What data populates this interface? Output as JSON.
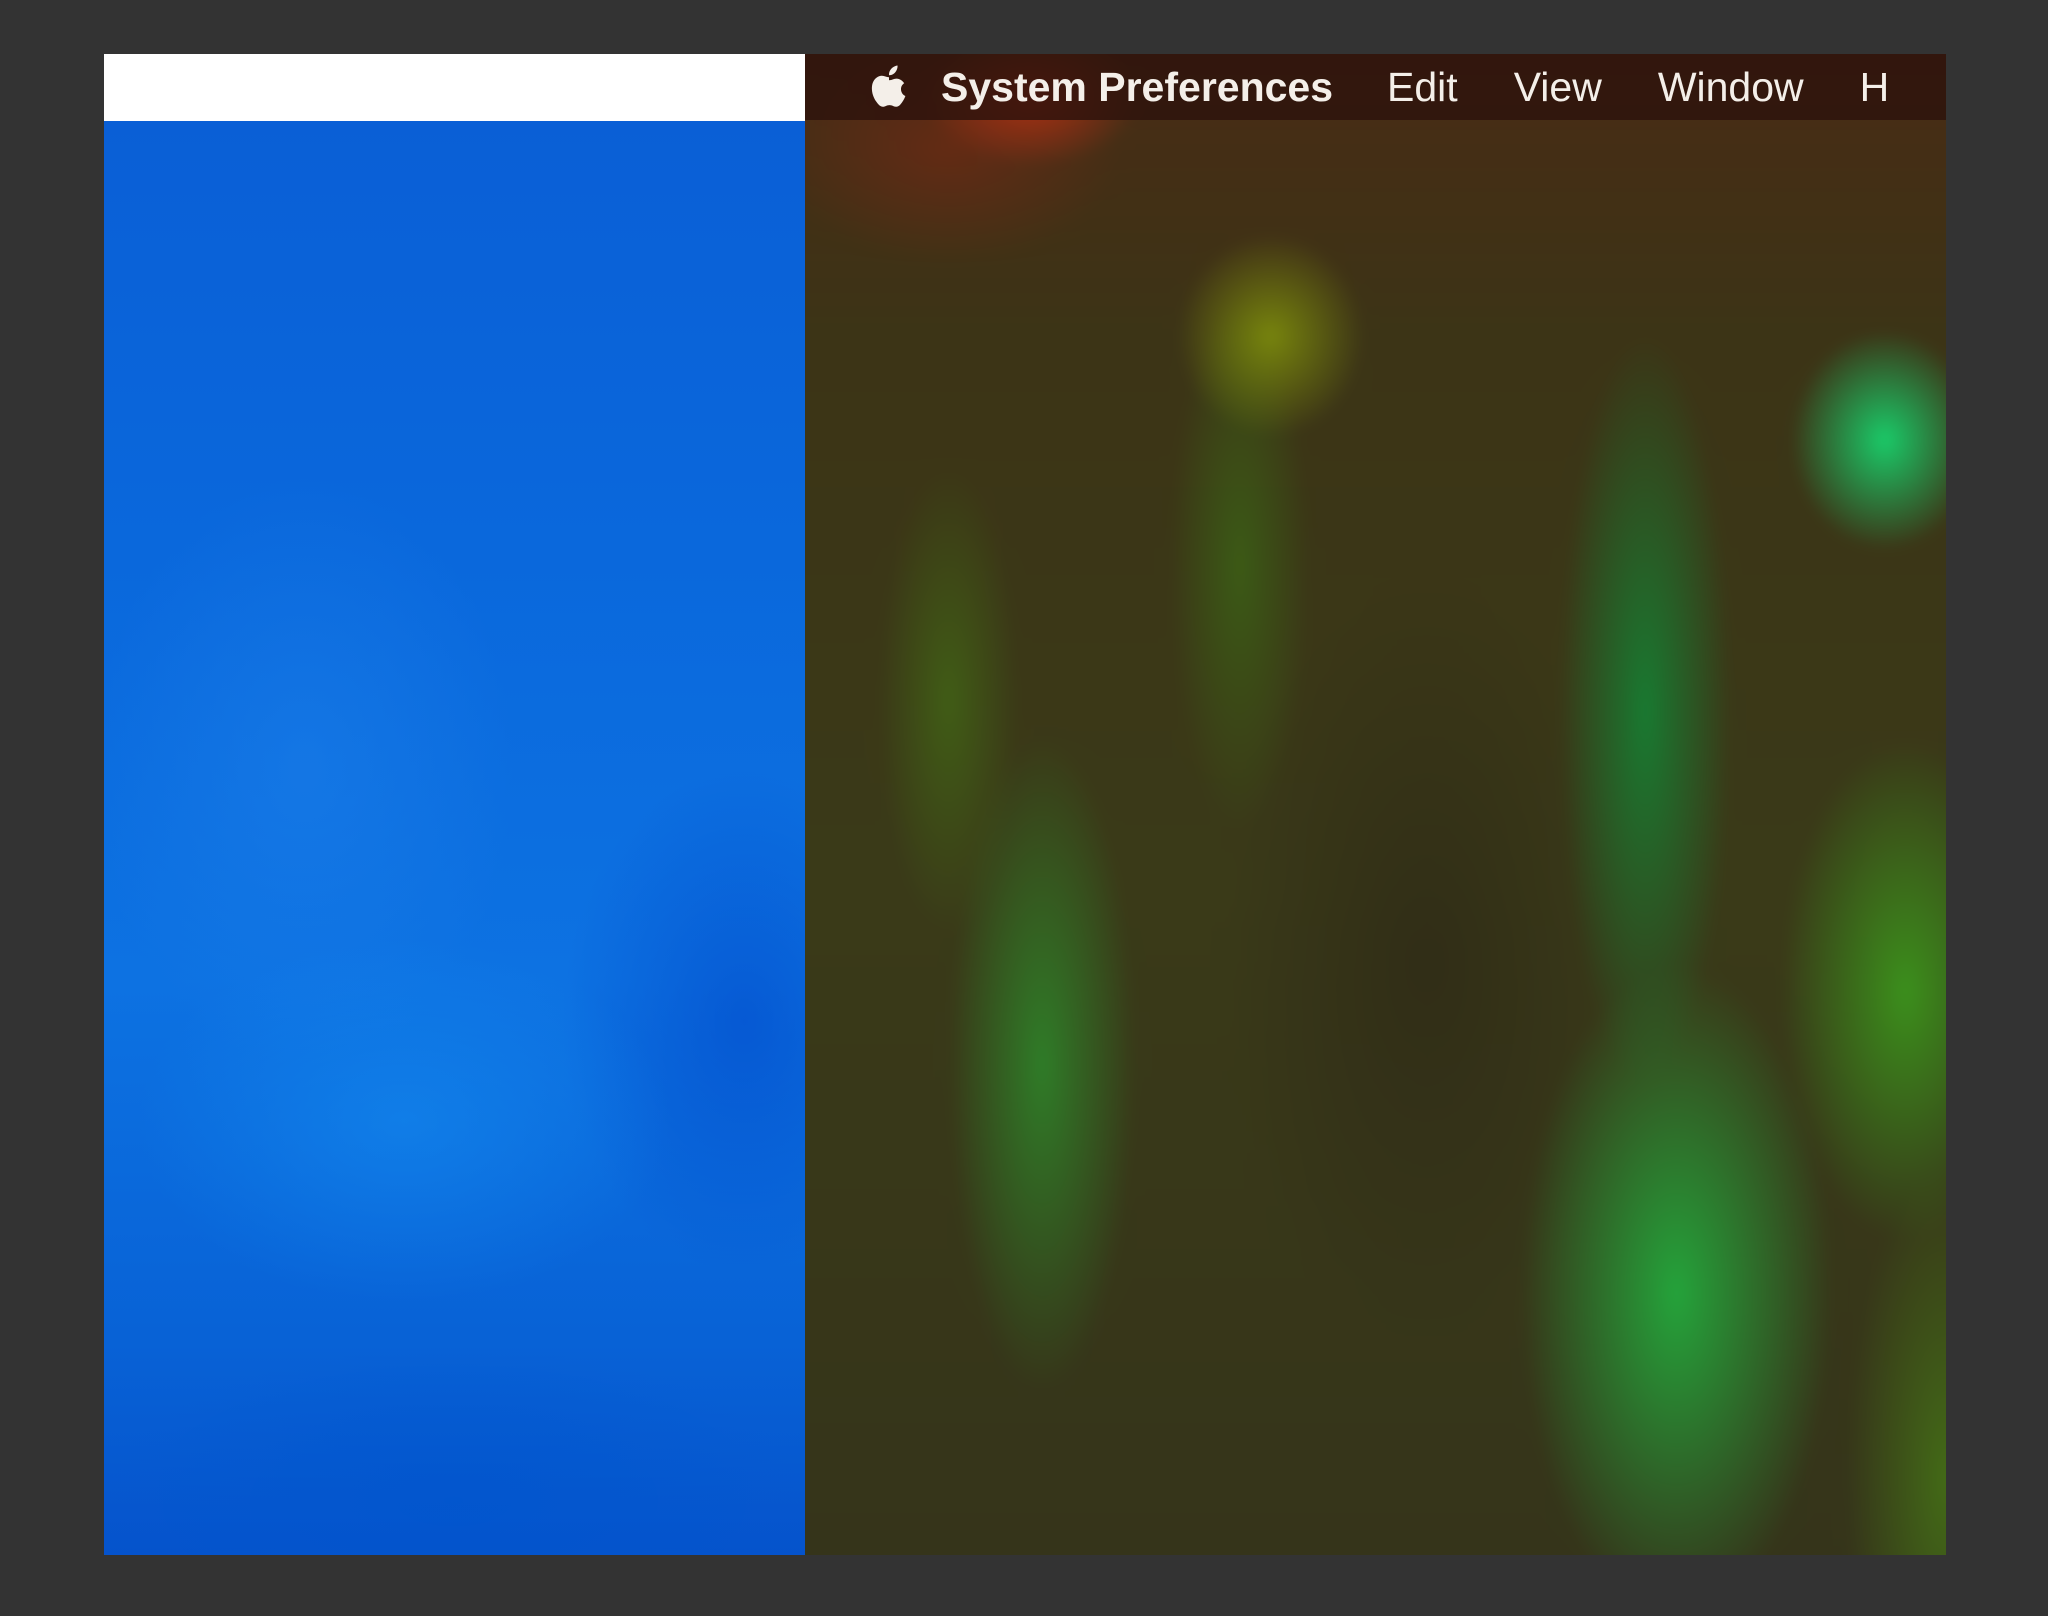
{
  "menubar": {
    "apple_menu": "apple-icon",
    "app_name": "System Preferences",
    "items": [
      "Edit",
      "View",
      "Window",
      "H"
    ]
  },
  "colors": {
    "outer_background": "#333333",
    "left_menubar": "#ffffff",
    "left_desktop_blue": "#0a68dc",
    "right_menubar": "#2d120c"
  }
}
